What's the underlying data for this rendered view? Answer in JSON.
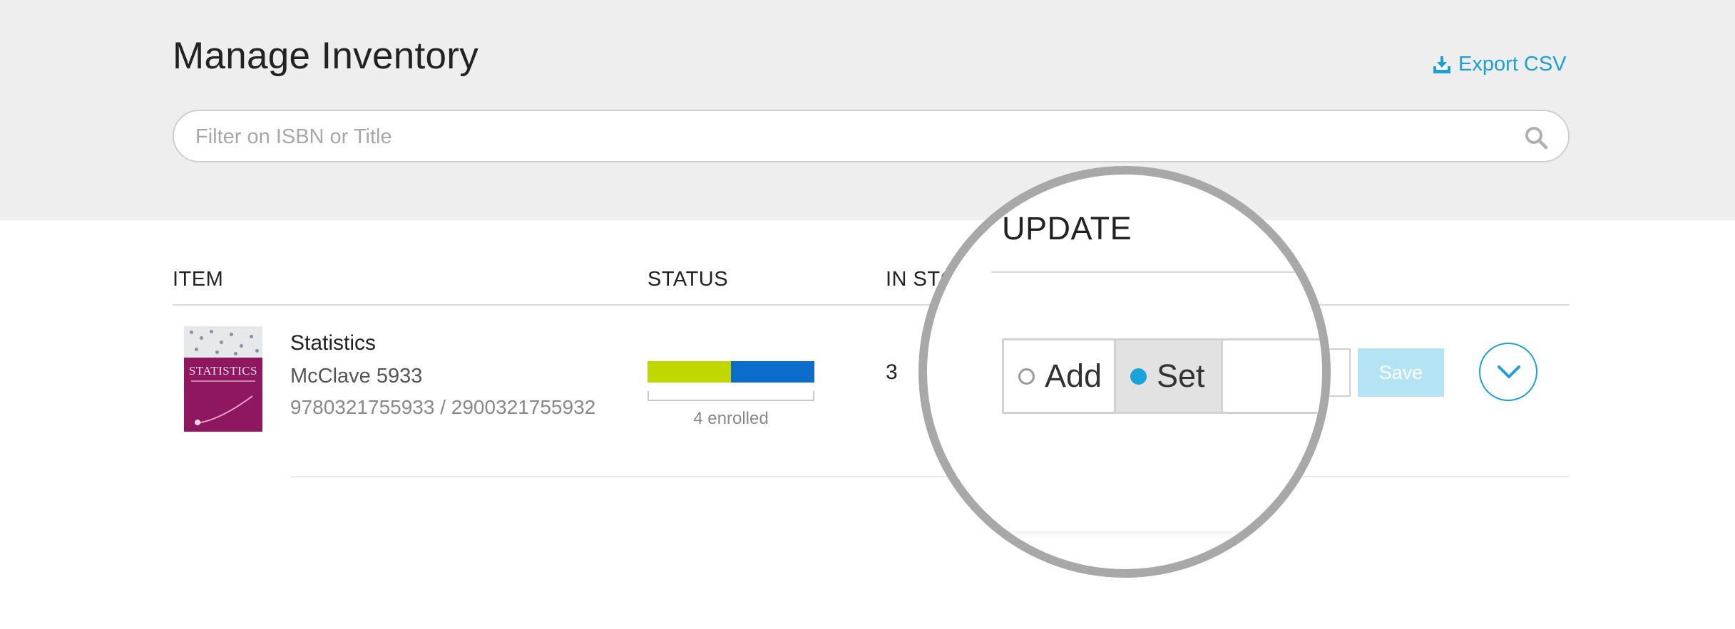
{
  "header": {
    "title": "Manage Inventory",
    "export_label": "Export CSV",
    "export_icon": "download-icon"
  },
  "search": {
    "placeholder": "Filter on ISBN or Title",
    "value": "",
    "icon": "search-icon"
  },
  "table": {
    "columns": [
      "ITEM",
      "STATUS",
      "IN STC",
      "UPDATE"
    ],
    "rows": [
      {
        "cover_title": "STATISTICS",
        "title": "Statistics",
        "author": "McClave 5933",
        "isbn": "9780321755933 / 2900321755932",
        "status": {
          "label": "4 enrolled",
          "segments": [
            {
              "fraction": 0.5,
              "color": "#c1d700"
            },
            {
              "fraction": 0.5,
              "color": "#0b6ccc"
            }
          ]
        },
        "in_stock": "3",
        "update": {
          "options": [
            "Add",
            "Set"
          ],
          "selected": "Set",
          "value": ""
        },
        "save_label": "Save"
      }
    ]
  },
  "colors": {
    "accent": "#1ba0d8",
    "header_bg": "#eeeeee",
    "save_disabled": "#b4e4f4"
  }
}
